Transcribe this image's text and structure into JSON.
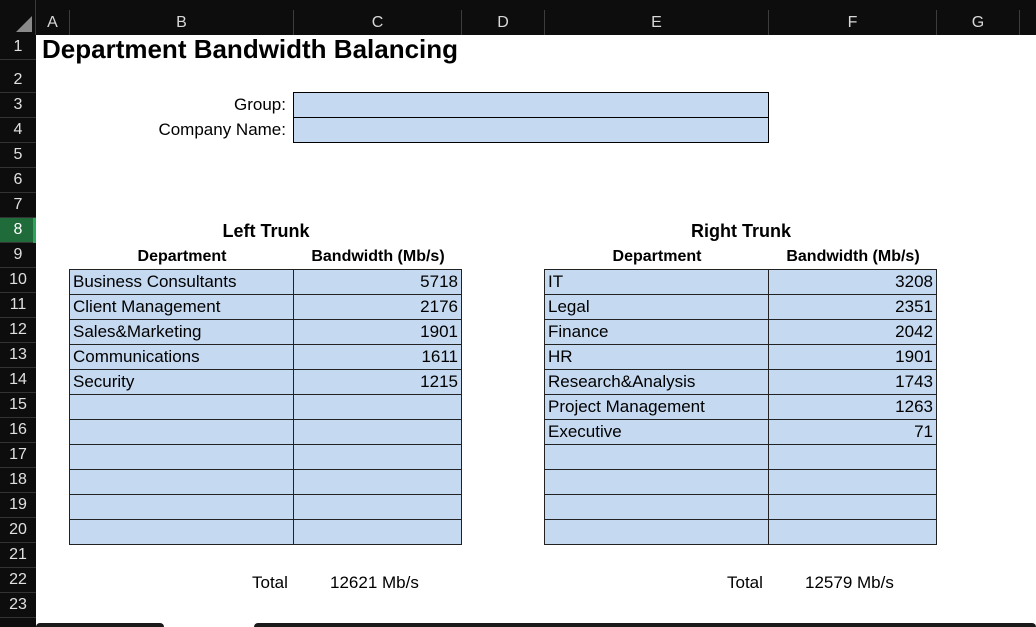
{
  "sheet": {
    "columns": [
      "A",
      "B",
      "C",
      "D",
      "E",
      "F",
      "G"
    ],
    "rows": [
      "1",
      "2",
      "3",
      "4",
      "5",
      "6",
      "7",
      "8",
      "9",
      "10",
      "11",
      "12",
      "13",
      "14",
      "15",
      "16",
      "17",
      "18",
      "19",
      "20",
      "21",
      "22",
      "23"
    ],
    "active_row": "8"
  },
  "title": "Department Bandwidth Balancing",
  "form": {
    "group_label": "Group:",
    "group_value": "",
    "company_label": "Company Name:",
    "company_value": ""
  },
  "left_trunk": {
    "caption": "Left Trunk",
    "dept_header": "Department",
    "bw_header": "Bandwidth (Mb/s)",
    "rows": [
      {
        "dept": "Business Consultants",
        "bw": "5718"
      },
      {
        "dept": "Client Management",
        "bw": "2176"
      },
      {
        "dept": "Sales&Marketing",
        "bw": "1901"
      },
      {
        "dept": "Communications",
        "bw": "1611"
      },
      {
        "dept": "Security",
        "bw": "1215"
      },
      {
        "dept": "",
        "bw": ""
      },
      {
        "dept": "",
        "bw": ""
      },
      {
        "dept": "",
        "bw": ""
      },
      {
        "dept": "",
        "bw": ""
      },
      {
        "dept": "",
        "bw": ""
      },
      {
        "dept": "",
        "bw": ""
      }
    ],
    "total_label": "Total",
    "total_value": "12621 Mb/s"
  },
  "right_trunk": {
    "caption": "Right Trunk",
    "dept_header": "Department",
    "bw_header": "Bandwidth (Mb/s)",
    "rows": [
      {
        "dept": "IT",
        "bw": "3208"
      },
      {
        "dept": "Legal",
        "bw": "2351"
      },
      {
        "dept": "Finance",
        "bw": "2042"
      },
      {
        "dept": "HR",
        "bw": "1901"
      },
      {
        "dept": "Research&Analysis",
        "bw": "1743"
      },
      {
        "dept": "Project Management",
        "bw": "1263"
      },
      {
        "dept": "Executive",
        "bw": "71"
      },
      {
        "dept": "",
        "bw": ""
      },
      {
        "dept": "",
        "bw": ""
      },
      {
        "dept": "",
        "bw": ""
      },
      {
        "dept": "",
        "bw": ""
      }
    ],
    "total_label": "Total",
    "total_value": "12579 Mb/s"
  }
}
